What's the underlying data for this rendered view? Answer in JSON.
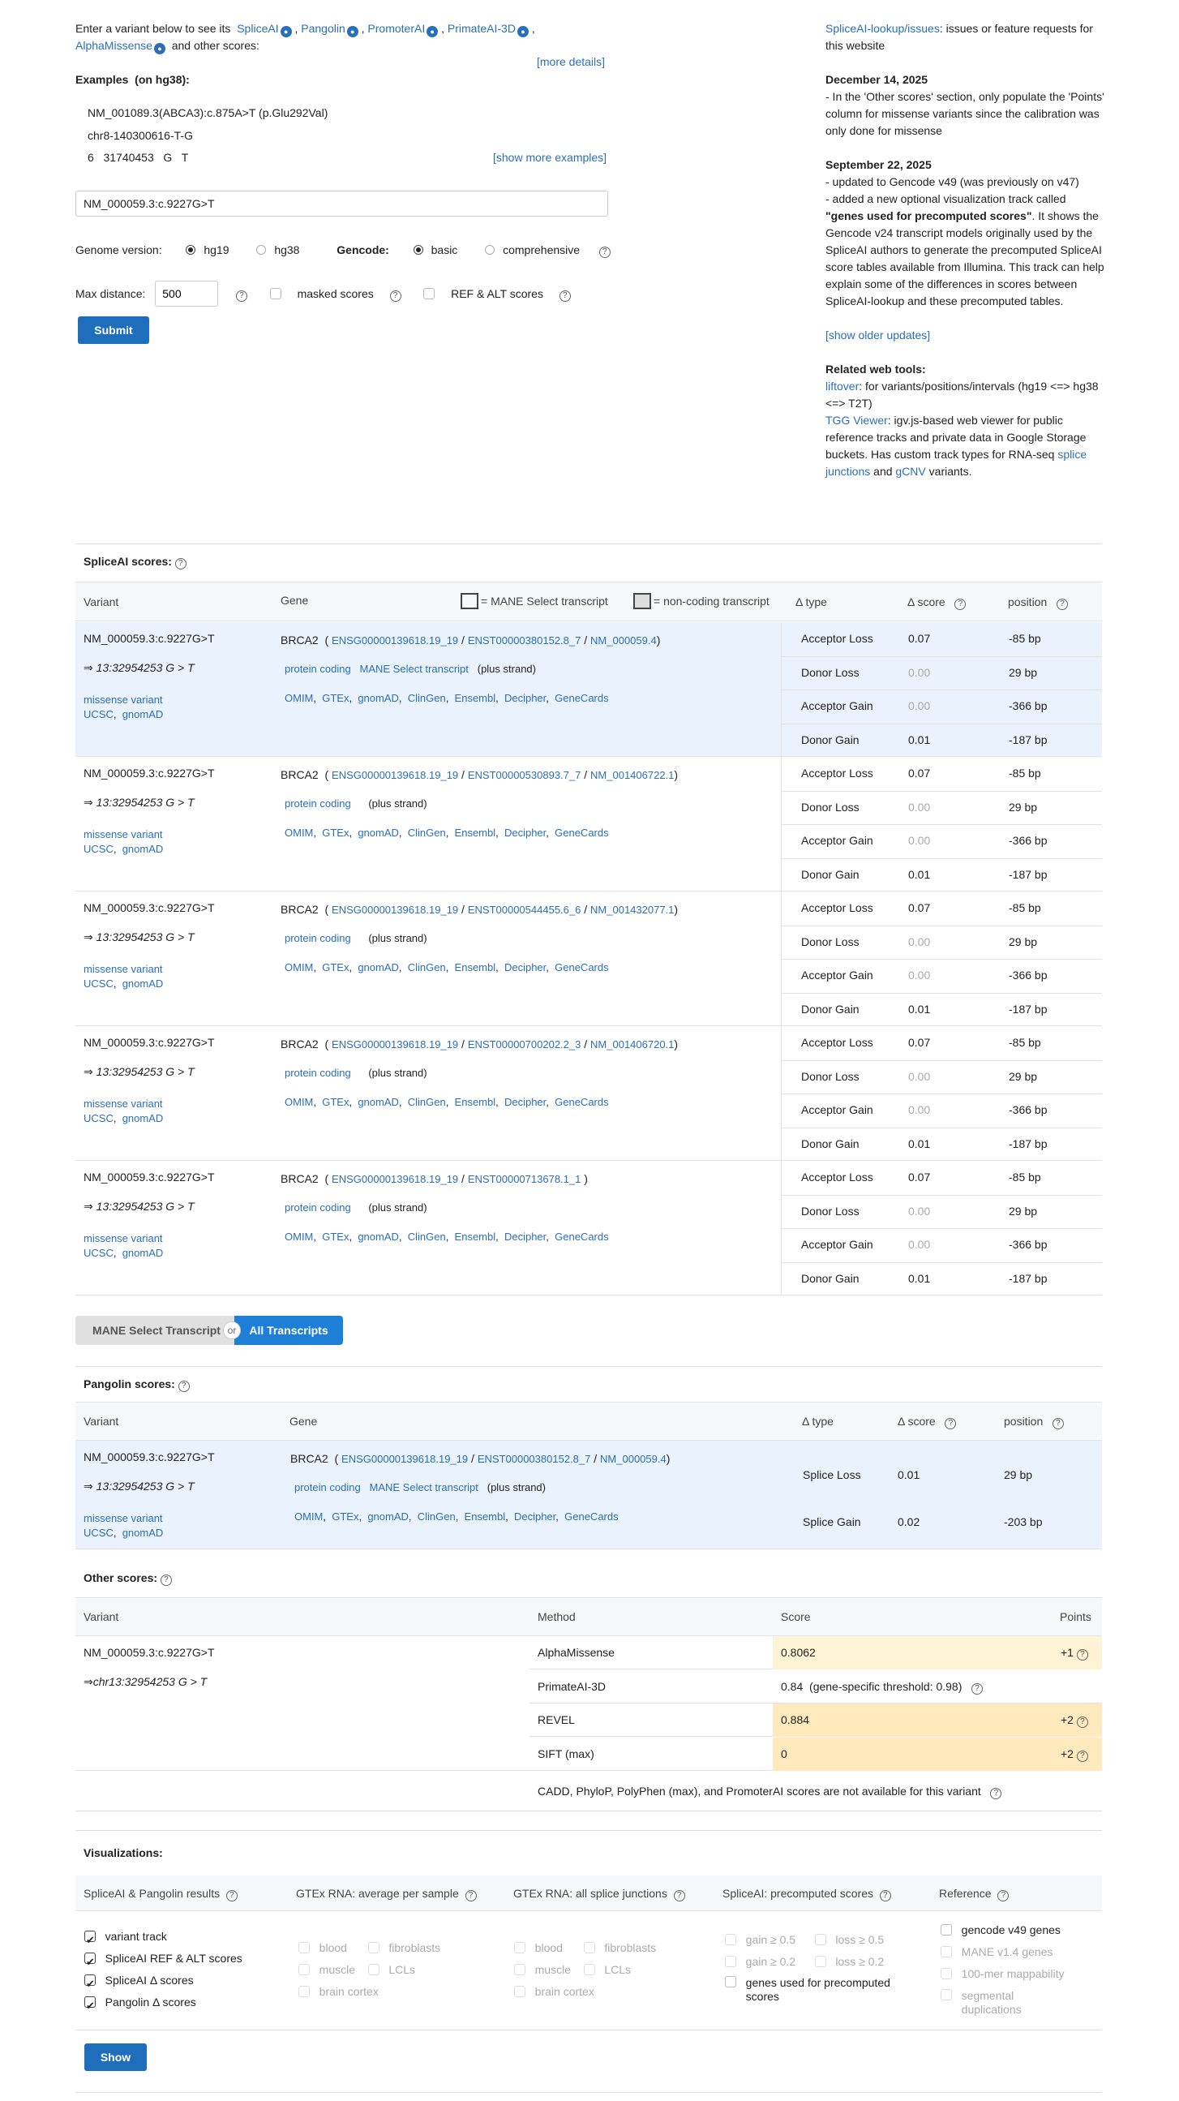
{
  "intro": {
    "text1": "Enter a variant below to see its",
    "tools": [
      "SpliceAI",
      "Pangolin",
      "PromoterAI",
      "PrimateAI-3D",
      "AlphaMissense"
    ],
    "text2": "and other scores:",
    "more_details": "[more details]"
  },
  "examples": {
    "title": "Examples",
    "subtitle": "(on hg38):",
    "items": [
      "NM_001089.3(ABCA3):c.875A>T (p.Glu292Val)",
      "chr8-140300616-T-G",
      "6   31740453   G   T"
    ],
    "show_more": "[show more examples]"
  },
  "search": {
    "value": "NM_000059.3:c.9227G>T",
    "placeholder": ""
  },
  "options": {
    "genome_label": "Genome version:",
    "genome_options": [
      "hg19",
      "hg38"
    ],
    "gencode_label": "Gencode:",
    "gencode_options": [
      "basic",
      "comprehensive"
    ],
    "max_distance_label": "Max distance:",
    "max_distance_value": "500",
    "masked_label": "masked scores",
    "refalt_label": "REF & ALT scores",
    "submit": "Submit"
  },
  "news": {
    "issues_link": "SpliceAI-lookup/issues",
    "issues_text": ": issues or feature requests for this website",
    "d1": "December 14, 2025",
    "d1_text": "- In the 'Other scores' section, only populate the 'Points' column for missense variants since the calibration was only done for missense",
    "d2": "September 22, 2025",
    "d2_l1": "- updated to Gencode v49 (was previously on v47)",
    "d2_l2a": "- added a new optional visualization track called",
    "d2_bold": "\"genes used for precomputed scores\"",
    "d2_l2b": ". It shows the Gencode v24 transcript models originally used by the SpliceAI authors to generate the precomputed SpliceAI score tables available from Illumina. This track can help explain some of the differences in scores between SpliceAI-lookup and these precomputed tables.",
    "show_older": "[show older updates]",
    "related_title": "Related web tools:",
    "liftover": "liftover",
    "liftover_text": ": for variants/positions/intervals (hg19 <=> hg38 <=> T2T)",
    "tgg": "TGG Viewer",
    "tgg_text": ": igv.js-based web viewer for public reference tracks and private data in Google Storage buckets. Has custom track types for RNA-seq",
    "splice_junctions": "splice junctions",
    "and": "and",
    "gcnv": "gCNV",
    "variants": "variants."
  },
  "spliceai": {
    "title": "SpliceAI scores:",
    "headers": {
      "variant": "Variant",
      "gene": "Gene",
      "mane": "= MANE Select transcript",
      "noncoding": "= non-coding transcript",
      "dtype": "Δ type",
      "dscore": "Δ score",
      "position": "position"
    },
    "variant": "NM_000059.3:c.9227G>T",
    "coord": "⇒ 13:32954253 G > T",
    "consequence": "missense variant",
    "links": [
      "UCSC",
      "gnomAD"
    ],
    "gene_links": [
      "OMIM",
      "GTEx",
      "gnomAD",
      "ClinGen",
      "Ensembl",
      "Decipher",
      "GeneCards"
    ],
    "rows": [
      {
        "gene": "BRCA2",
        "ensg": "ENSG00000139618.19_19",
        "enst": "ENST00000380152.8_7",
        "nm": "NM_000059.4",
        "biotype": "protein coding",
        "mane": "MANE Select transcript",
        "strand": "(plus strand)",
        "scores": [
          [
            "Acceptor Loss",
            "0.07",
            "-85 bp"
          ],
          [
            "Donor Loss",
            "0.00",
            "29 bp"
          ],
          [
            "Acceptor Gain",
            "0.00",
            "-366 bp"
          ],
          [
            "Donor Gain",
            "0.01",
            "-187 bp"
          ]
        ]
      },
      {
        "gene": "BRCA2",
        "ensg": "ENSG00000139618.19_19",
        "enst": "ENST00000530893.7_7",
        "nm": "NM_001406722.1",
        "biotype": "protein coding",
        "mane": "",
        "strand": "(plus strand)",
        "scores": [
          [
            "Acceptor Loss",
            "0.07",
            "-85 bp"
          ],
          [
            "Donor Loss",
            "0.00",
            "29 bp"
          ],
          [
            "Acceptor Gain",
            "0.00",
            "-366 bp"
          ],
          [
            "Donor Gain",
            "0.01",
            "-187 bp"
          ]
        ]
      },
      {
        "gene": "BRCA2",
        "ensg": "ENSG00000139618.19_19",
        "enst": "ENST00000544455.6_6",
        "nm": "NM_001432077.1",
        "biotype": "protein coding",
        "mane": "",
        "strand": "(plus strand)",
        "scores": [
          [
            "Acceptor Loss",
            "0.07",
            "-85 bp"
          ],
          [
            "Donor Loss",
            "0.00",
            "29 bp"
          ],
          [
            "Acceptor Gain",
            "0.00",
            "-366 bp"
          ],
          [
            "Donor Gain",
            "0.01",
            "-187 bp"
          ]
        ]
      },
      {
        "gene": "BRCA2",
        "ensg": "ENSG00000139618.19_19",
        "enst": "ENST00000700202.2_3",
        "nm": "NM_001406720.1",
        "biotype": "protein coding",
        "mane": "",
        "strand": "(plus strand)",
        "scores": [
          [
            "Acceptor Loss",
            "0.07",
            "-85 bp"
          ],
          [
            "Donor Loss",
            "0.00",
            "29 bp"
          ],
          [
            "Acceptor Gain",
            "0.00",
            "-366 bp"
          ],
          [
            "Donor Gain",
            "0.01",
            "-187 bp"
          ]
        ]
      },
      {
        "gene": "BRCA2",
        "ensg": "ENSG00000139618.19_19",
        "enst": "ENST00000713678.1_1",
        "nm": "",
        "biotype": "protein coding",
        "mane": "",
        "strand": "(plus strand)",
        "scores": [
          [
            "Acceptor Loss",
            "0.07",
            "-85 bp"
          ],
          [
            "Donor Loss",
            "0.00",
            "29 bp"
          ],
          [
            "Acceptor Gain",
            "0.00",
            "-366 bp"
          ],
          [
            "Donor Gain",
            "0.01",
            "-187 bp"
          ]
        ]
      }
    ]
  },
  "toggle": {
    "left": "MANE Select Transcript",
    "or": "or",
    "right": "All Transcripts"
  },
  "pangolin": {
    "title": "Pangolin scores:",
    "headers": {
      "variant": "Variant",
      "gene": "Gene",
      "dtype": "Δ type",
      "dscore": "Δ score",
      "position": "position"
    },
    "gene": "BRCA2",
    "ensg": "ENSG00000139618.19_19",
    "enst": "ENST00000380152.8_7",
    "nm": "NM_000059.4",
    "biotype": "protein coding",
    "mane": "MANE Select transcript",
    "strand": "(plus strand)",
    "scores": [
      [
        "Splice Loss",
        "0.01",
        "29 bp"
      ],
      [
        "Splice Gain",
        "0.02",
        "-203 bp"
      ]
    ]
  },
  "other": {
    "title": "Other scores:",
    "headers": {
      "variant": "Variant",
      "method": "Method",
      "score": "Score",
      "points": "Points"
    },
    "variant": "NM_000059.3:c.9227G>T",
    "coord": "⇒chr13:32954253 G > T",
    "rows": [
      {
        "method": "AlphaMissense",
        "score": "0.8062",
        "points": "+1"
      },
      {
        "method": "PrimateAI-3D",
        "score": "0.84  (gene-specific threshold: 0.98)",
        "points": ""
      },
      {
        "method": "REVEL",
        "score": "0.884",
        "points": "+2"
      },
      {
        "method": "SIFT (max)",
        "score": "0",
        "points": "+2"
      }
    ],
    "na_note": "CADD,  PhyloP,  PolyPhen (max),  and PromoterAI scores are not available for this variant"
  },
  "viz": {
    "title": "Visualizations:",
    "col_headers": [
      "SpliceAI & Pangolin results",
      "GTEx RNA: average per sample",
      "GTEx RNA: all splice junctions",
      "SpliceAI: precomputed scores",
      "Reference"
    ],
    "results": [
      "variant track",
      "SpliceAI REF & ALT scores",
      "SpliceAI Δ scores",
      "Pangolin Δ scores"
    ],
    "gtex1": [
      "blood",
      "fibroblasts",
      "muscle",
      "LCLs",
      "brain cortex"
    ],
    "gtex2": [
      "blood",
      "fibroblasts",
      "muscle",
      "LCLs",
      "brain cortex"
    ],
    "precomp": [
      "gain ≥ 0.5",
      "loss ≥ 0.5",
      "gain ≥ 0.2",
      "loss ≥ 0.2",
      "genes used for precomputed scores"
    ],
    "reference": [
      "gencode v49 genes",
      "MANE v1.4 genes",
      "100-mer mappability",
      "segmental duplications"
    ],
    "show": "Show"
  },
  "colors": {
    "link": "#2a6fb8",
    "button": "#1f6ebc",
    "highlight": "#eaf2fd",
    "score_highlight": "#fff3d6"
  }
}
